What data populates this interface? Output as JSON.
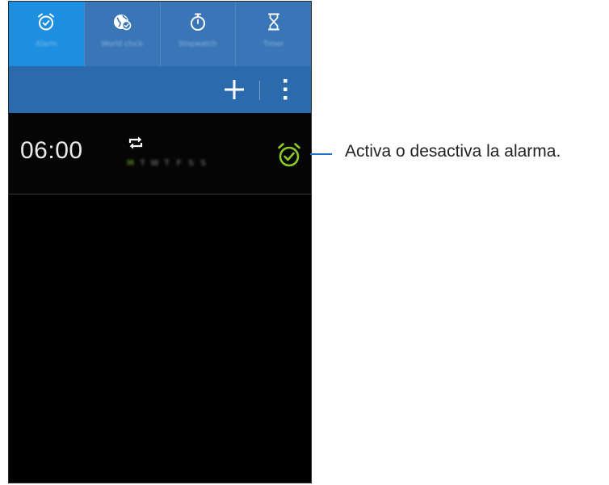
{
  "tabs": [
    {
      "label": "Alarm",
      "icon": "alarm-clock-icon",
      "active": true
    },
    {
      "label": "World clock",
      "icon": "globe-icon",
      "active": false
    },
    {
      "label": "Stopwatch",
      "icon": "stopwatch-icon",
      "active": false
    },
    {
      "label": "Timer",
      "icon": "hourglass-icon",
      "active": false
    }
  ],
  "actions": {
    "add_icon": "plus-icon",
    "menu_icon": "more-vertical-icon"
  },
  "alarm": {
    "time": "06:00",
    "repeat_icon": "repeat-icon",
    "days": [
      "M",
      "T",
      "W",
      "T",
      "F",
      "S",
      "S"
    ],
    "active_days": [
      0
    ],
    "enabled": true,
    "toggle_icon": "alarm-clock-icon"
  },
  "callout": {
    "text": "Activa o desactiva la alarma."
  },
  "colors": {
    "tab_bar": "#3a76b7",
    "tab_active": "#1e8fe0",
    "action_bar": "#2b6aad",
    "alarm_on": "#8ac926",
    "callout_line": "#1a73c8"
  }
}
